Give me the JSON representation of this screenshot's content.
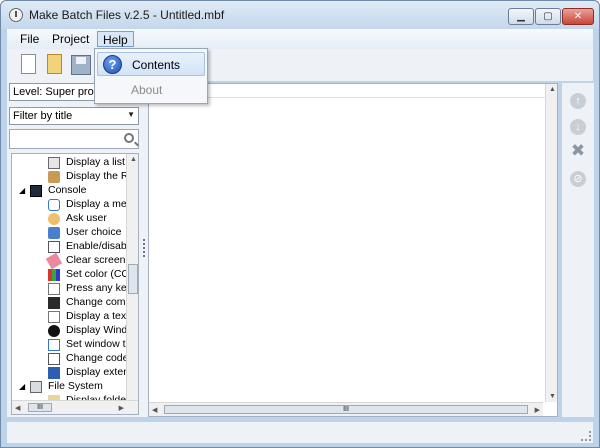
{
  "window": {
    "title": "Make Batch Files v.2.5 - Untitled.mbf"
  },
  "menubar": {
    "items": [
      {
        "label": "File"
      },
      {
        "label": "Project"
      },
      {
        "label": "Help"
      }
    ]
  },
  "help_menu": {
    "items": [
      {
        "label": "Contents",
        "icon": "help-icon",
        "enabled": true
      },
      {
        "label": "About",
        "enabled": false
      }
    ]
  },
  "left_panel": {
    "level_select": {
      "value": "Level: Super pro"
    },
    "filter_select": {
      "value": "Filter by title"
    },
    "search": {
      "value": "",
      "placeholder": ""
    },
    "tree": [
      {
        "label": "Display a list o",
        "kind": "child"
      },
      {
        "label": "Display the Re",
        "kind": "child"
      },
      {
        "label": "Console",
        "kind": "parent"
      },
      {
        "label": "Display a mes",
        "kind": "child"
      },
      {
        "label": "Ask user",
        "kind": "child"
      },
      {
        "label": "User choice",
        "kind": "child"
      },
      {
        "label": "Enable/disable",
        "kind": "child"
      },
      {
        "label": "Clear screen (",
        "kind": "child"
      },
      {
        "label": "Set color (CO",
        "kind": "child"
      },
      {
        "label": "Press any key",
        "kind": "child"
      },
      {
        "label": "Change comm",
        "kind": "child"
      },
      {
        "label": "Display a text",
        "kind": "child"
      },
      {
        "label": "Display Windo",
        "kind": "child"
      },
      {
        "label": "Set window ti",
        "kind": "child"
      },
      {
        "label": "Change code",
        "kind": "child"
      },
      {
        "label": "Display exten",
        "kind": "child"
      },
      {
        "label": "File System",
        "kind": "parent"
      },
      {
        "label": "Display folder",
        "kind": "child"
      }
    ],
    "tree_scroll": {
      "grip": "III"
    }
  },
  "editor": {
    "scroll": {
      "grip": "III"
    }
  },
  "colors": {
    "accent": "#1d4fb3",
    "chrome": "#bcd3ea",
    "close": "#c9463a"
  }
}
